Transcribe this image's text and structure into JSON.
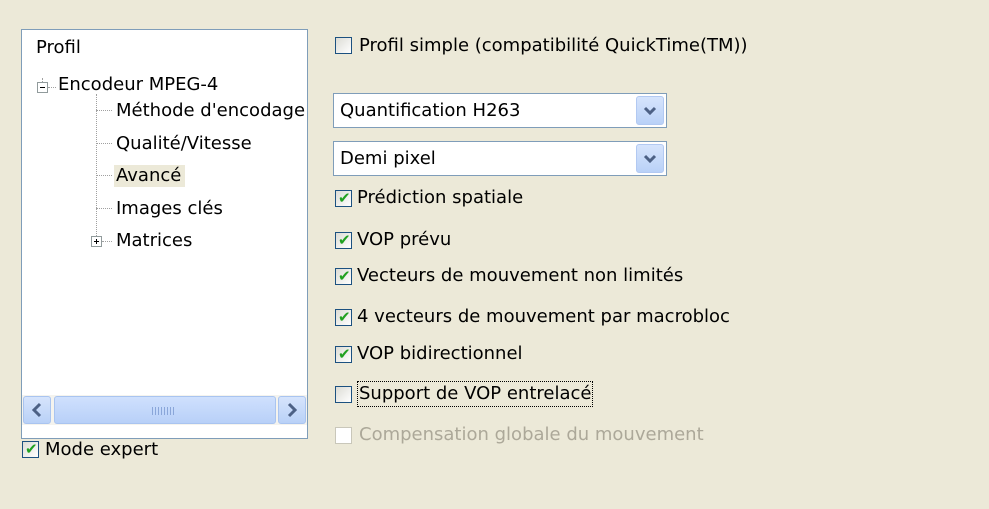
{
  "tree": {
    "root": "Profil",
    "encoder": "Encodeur MPEG-4",
    "children": [
      "Méthode d'encodage",
      "Qualité/Vitesse",
      "Avancé",
      "Images clés",
      "Matrices"
    ],
    "selected": "Avancé"
  },
  "mode_expert": {
    "label": "Mode expert",
    "checked": true
  },
  "simple_profile": {
    "label": "Profil simple (compatibilité QuickTime(TM))",
    "checked": false
  },
  "quant_select": {
    "value": "Quantification H263"
  },
  "pixel_select": {
    "value": "Demi pixel"
  },
  "options": [
    {
      "label": "Prédiction spatiale",
      "checked": true
    },
    {
      "label": "VOP prévu",
      "checked": true
    },
    {
      "label": "Vecteurs de mouvement non limités",
      "checked": true
    },
    {
      "label": "4 vecteurs de mouvement par macrobloc",
      "checked": true
    },
    {
      "label": "VOP bidirectionnel",
      "checked": true
    },
    {
      "label": "Support de VOP entrelacé",
      "checked": false
    },
    {
      "label": "Compensation globale du mouvement",
      "checked": false,
      "disabled": true
    }
  ],
  "colors": {
    "check": "#21a121",
    "panel_bg": "#ece9d8",
    "border": "#7f9db9"
  }
}
